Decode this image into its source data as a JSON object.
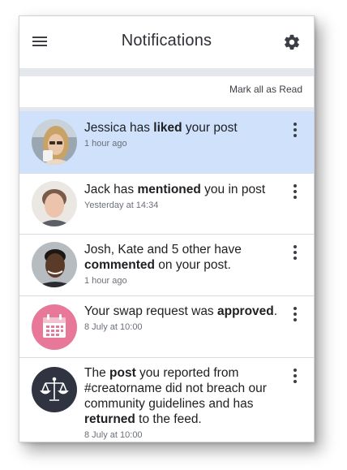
{
  "header": {
    "title": "Notifications",
    "menu_icon": "hamburger-menu-icon",
    "settings_icon": "gear-icon"
  },
  "toolbar": {
    "mark_all_label": "Mark all as Read"
  },
  "notifications": [
    {
      "avatar": "photo-jessica",
      "parts": [
        "Jessica has ",
        "liked",
        " your post"
      ],
      "time": "1 hour ago",
      "highlighted": true
    },
    {
      "avatar": "photo-jack",
      "parts": [
        "Jack has ",
        "mentioned",
        " you in post"
      ],
      "time": "Yesterday at 14:34",
      "highlighted": false
    },
    {
      "avatar": "photo-josh",
      "parts": [
        "Josh, Kate and 5 other have ",
        "commented",
        " on your post."
      ],
      "time": "1 hour ago",
      "highlighted": false
    },
    {
      "avatar": "calendar-icon",
      "parts": [
        "Your swap request was ",
        "approved",
        "."
      ],
      "time": "8 July at 10:00",
      "highlighted": false
    },
    {
      "avatar": "scales-of-justice-icon",
      "parts": [
        "The ",
        "post",
        " you reported from #creatorname did not breach our community guidelines and has ",
        "returned",
        " to the feed."
      ],
      "time": "8 July at 10:00",
      "highlighted": false
    }
  ],
  "colors": {
    "highlight": "#cfe1fb",
    "calendar_bg": "#e8789a",
    "scales_bg": "#2f3440"
  }
}
